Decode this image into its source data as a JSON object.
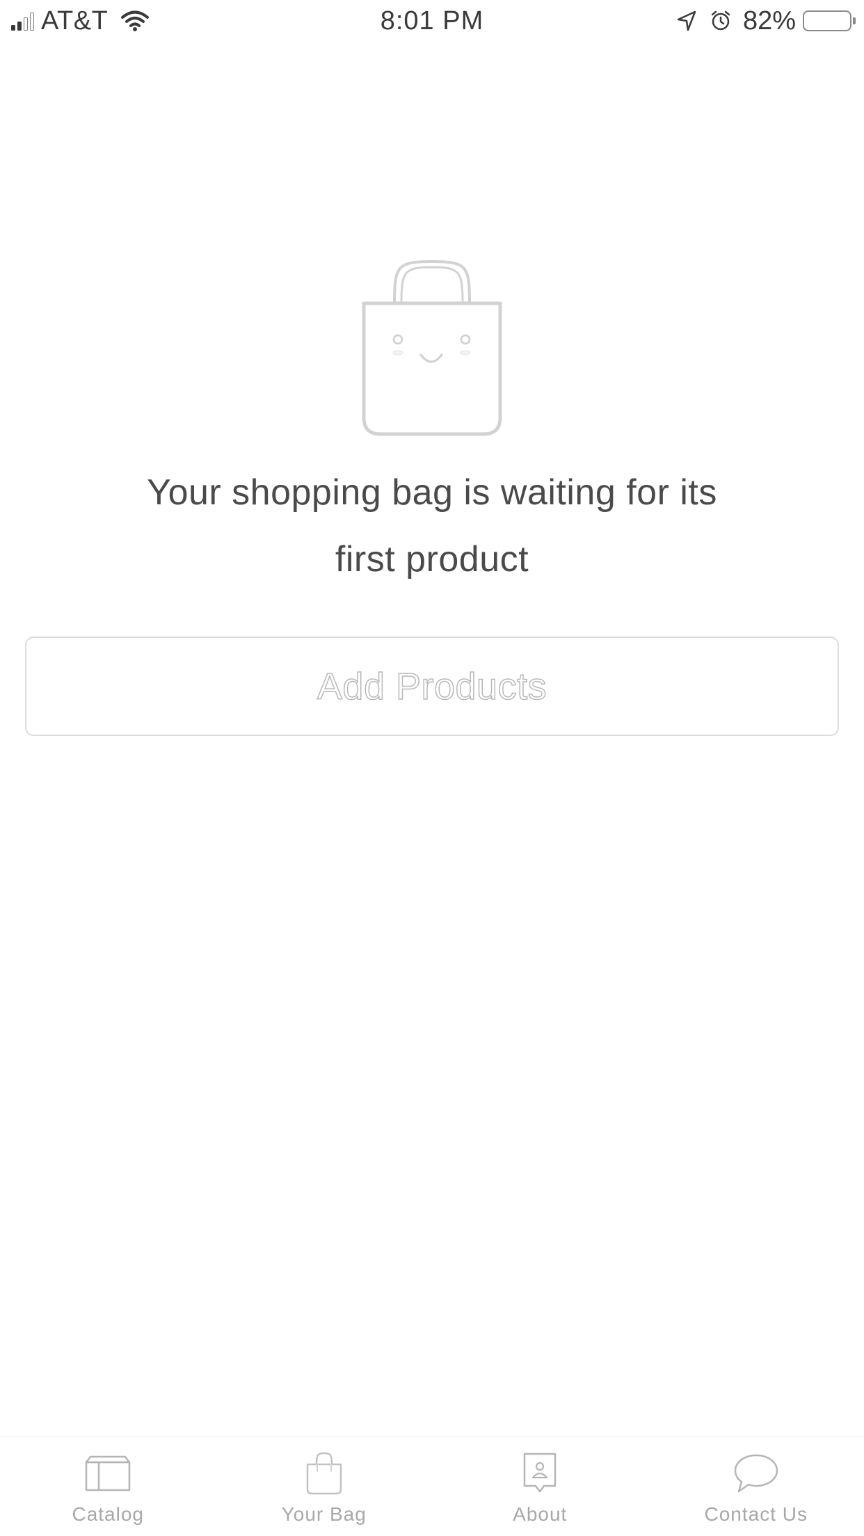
{
  "status_bar": {
    "carrier": "AT&T",
    "time": "8:01 PM",
    "battery_percent": "82%",
    "signal_bars_filled": 2,
    "signal_bars_total": 4,
    "icons": [
      "signal-icon",
      "wifi-icon",
      "location-icon",
      "alarm-icon",
      "battery-icon"
    ]
  },
  "empty_state": {
    "illustration": "smiling-shopping-bag-icon",
    "message_line1": "Your shopping bag is waiting for its",
    "message_line2": "first product",
    "button_label": "Add Products"
  },
  "tab_bar": {
    "items": [
      {
        "label": "Catalog",
        "icon": "catalog-box-icon"
      },
      {
        "label": "Your Bag",
        "icon": "bag-icon"
      },
      {
        "label": "About",
        "icon": "about-person-icon"
      },
      {
        "label": "Contact Us",
        "icon": "chat-bubble-icon"
      }
    ]
  },
  "colors": {
    "text": "#4a4a4a",
    "muted": "#a8a8a8",
    "border": "#dcdcdc",
    "illustration_stroke": "#d2d2d2",
    "background": "#ffffff"
  }
}
